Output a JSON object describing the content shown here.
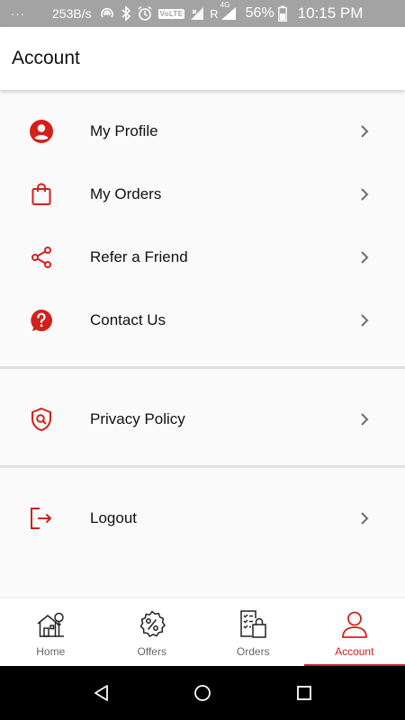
{
  "status_bar": {
    "dots": "···",
    "network_speed": "253B/s",
    "volte": "VoLTE",
    "roaming": "R",
    "network_type": "4G",
    "battery_percent": "56%",
    "time": "10:15 PM"
  },
  "app_bar": {
    "title": "Account"
  },
  "menu": {
    "group1": [
      {
        "label": "My Profile",
        "icon": "profile-icon"
      },
      {
        "label": "My Orders",
        "icon": "shopping-bag-icon"
      },
      {
        "label": "Refer a Friend",
        "icon": "share-icon"
      },
      {
        "label": "Contact Us",
        "icon": "help-icon"
      }
    ],
    "group2": [
      {
        "label": "Privacy Policy",
        "icon": "shield-search-icon"
      }
    ],
    "group3": [
      {
        "label": "Logout",
        "icon": "logout-icon"
      }
    ]
  },
  "bottom_nav": {
    "items": [
      {
        "label": "Home",
        "icon": "home-icon",
        "active": false
      },
      {
        "label": "Offers",
        "icon": "offers-icon",
        "active": false
      },
      {
        "label": "Orders",
        "icon": "orders-icon",
        "active": false
      },
      {
        "label": "Account",
        "icon": "account-icon",
        "active": true
      }
    ]
  },
  "colors": {
    "accent": "#d3201b",
    "status_bar_bg": "#a3a3a3",
    "background": "#fafafa",
    "divider": "#e2e2e2"
  }
}
